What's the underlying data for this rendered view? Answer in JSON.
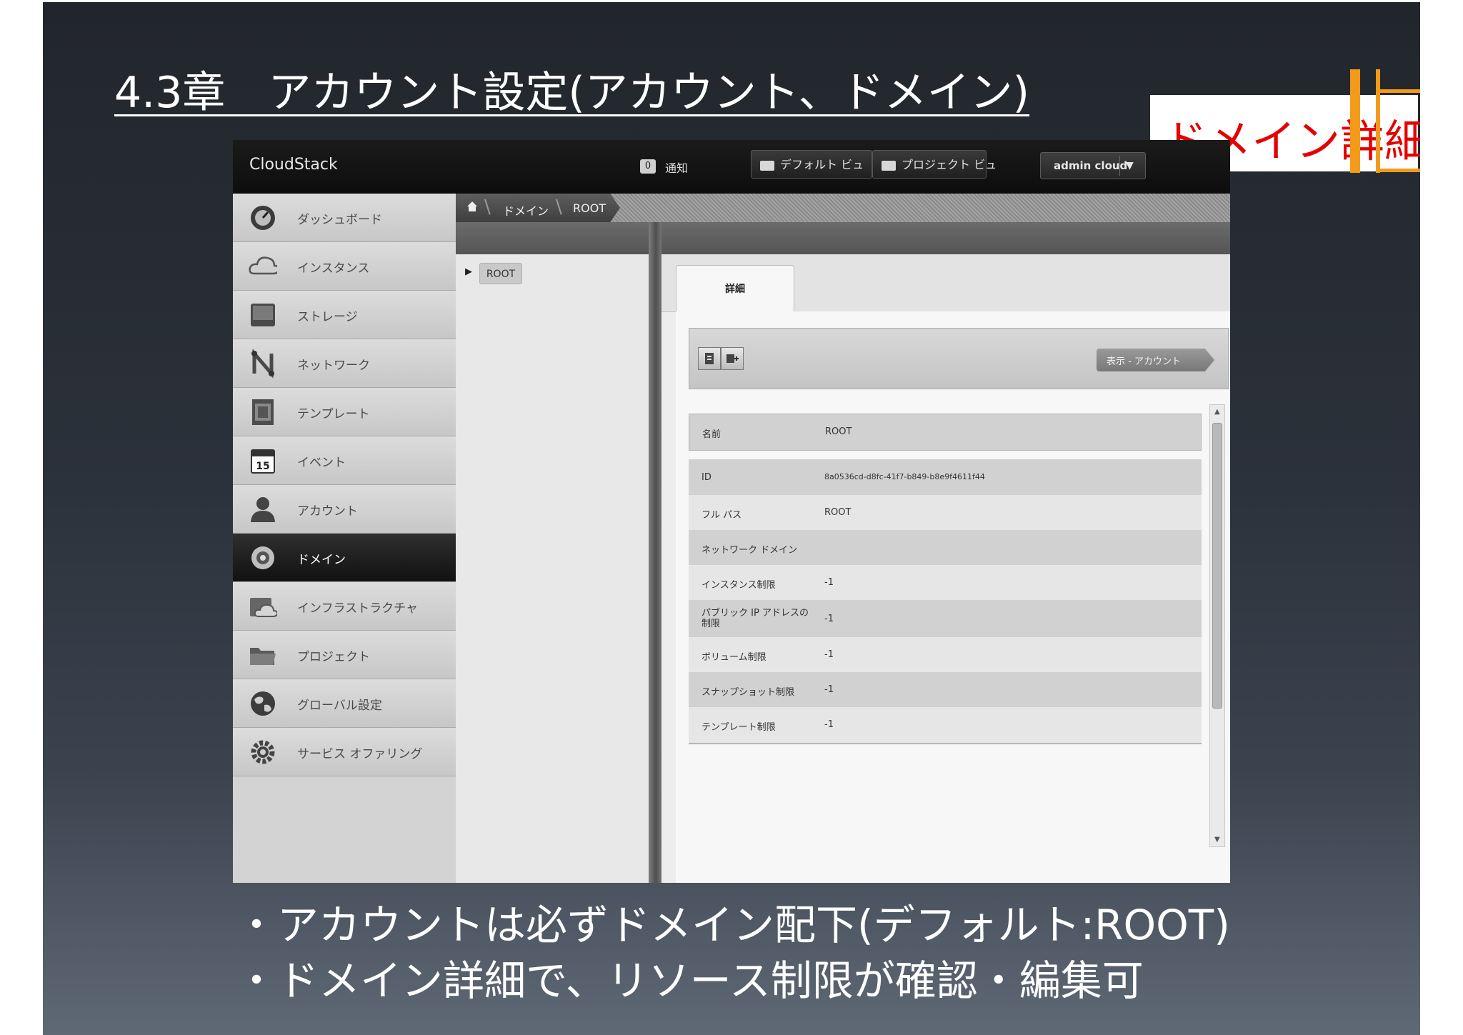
{
  "slide": {
    "title": "4.3章　アカウント設定(アカウント、ドメイン)",
    "callout": "ドメイン詳細",
    "bullets": [
      "・アカウントは必ずドメイン配下(デフォルト:ROOT)",
      "・ドメイン詳細で、リソース制限が確認・編集可"
    ]
  },
  "app": {
    "logo": "CloudStack",
    "notifications": {
      "count": "0",
      "label": "通知"
    },
    "default_view": "デフォルト ビュ",
    "project_view": "プロジェクト ビュ",
    "user": "admin cloud",
    "user_caret": "▼"
  },
  "sidebar": {
    "items": [
      {
        "label": "ダッシュボード",
        "icon": "dashboard-icon"
      },
      {
        "label": "インスタンス",
        "icon": "cloud-icon"
      },
      {
        "label": "ストレージ",
        "icon": "storage-icon"
      },
      {
        "label": "ネットワーク",
        "icon": "network-icon"
      },
      {
        "label": "テンプレート",
        "icon": "template-icon"
      },
      {
        "label": "イベント",
        "icon": "calendar-icon",
        "day": "15"
      },
      {
        "label": "アカウント",
        "icon": "user-icon"
      },
      {
        "label": "ドメイン",
        "icon": "domain-icon",
        "active": true
      },
      {
        "label": "インフラストラクチャ",
        "icon": "infrastructure-icon"
      },
      {
        "label": "プロジェクト",
        "icon": "folder-icon"
      },
      {
        "label": "グローバル設定",
        "icon": "globe-icon"
      },
      {
        "label": "サービス オファリング",
        "icon": "gear-icon"
      }
    ]
  },
  "breadcrumb": {
    "home_icon": "home-icon",
    "items": [
      "ドメイン",
      "ROOT"
    ]
  },
  "tree": {
    "root": "ROOT",
    "arrow": "▶"
  },
  "detail": {
    "tab": "詳細",
    "view_accounts": "表示 - アカウント",
    "actions": [
      "edit-icon",
      "add-icon"
    ],
    "fields": [
      {
        "key": "名前",
        "value": "ROOT"
      },
      {
        "key": "ID",
        "value": "8a0536cd-d8fc-41f7-b849-b8e9f4611f44"
      },
      {
        "key": "フル パス",
        "value": "ROOT"
      },
      {
        "key": "ネットワーク ドメイン",
        "value": ""
      },
      {
        "key": "インスタンス制限",
        "value": "-1"
      },
      {
        "key": "パブリック IP アドレスの制限",
        "value": "-1"
      },
      {
        "key": "ボリューム制限",
        "value": "-1"
      },
      {
        "key": "スナップショット制限",
        "value": "-1"
      },
      {
        "key": "テンプレート制限",
        "value": "-1"
      }
    ],
    "scroll_up": "▲",
    "scroll_down": "▼"
  },
  "colors": {
    "callout_text": "#e60000",
    "callout_accent": "#f39a1b"
  }
}
